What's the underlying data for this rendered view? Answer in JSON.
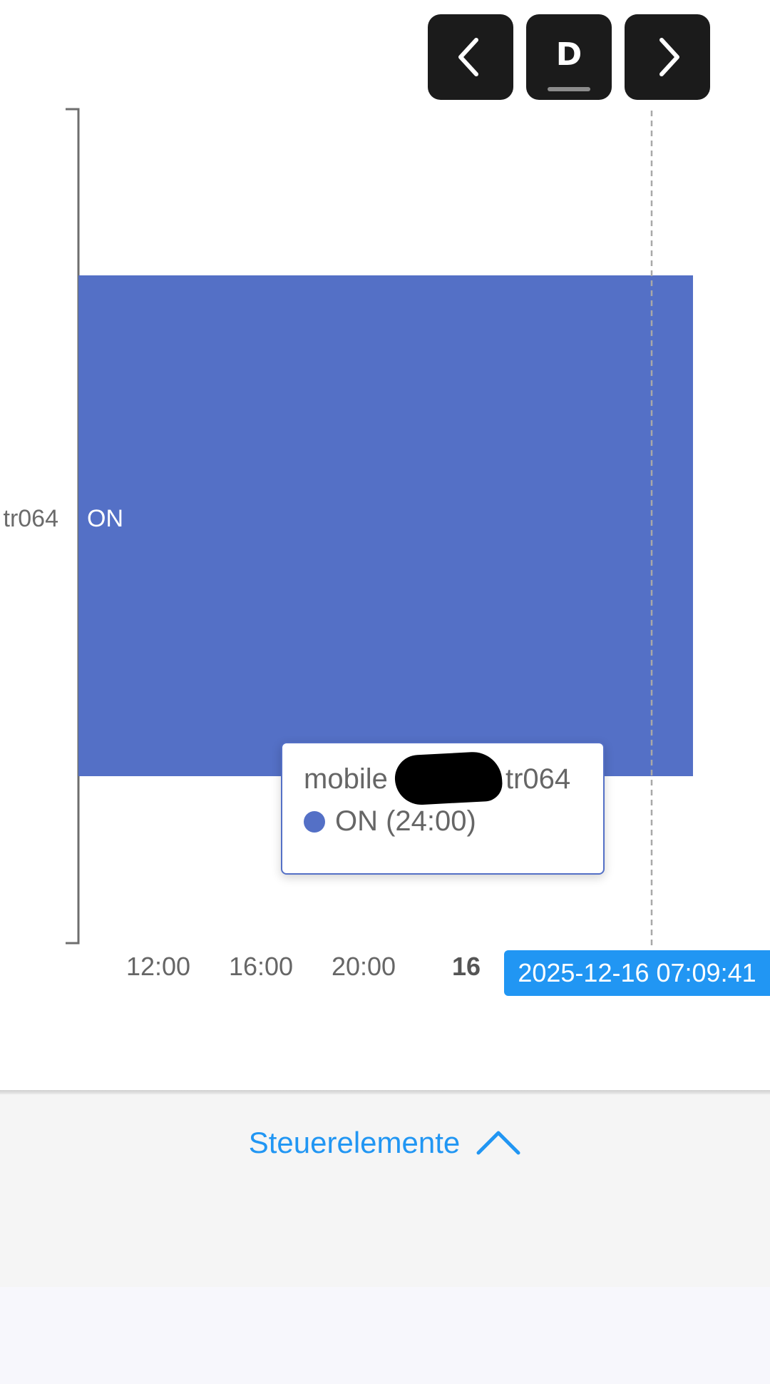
{
  "toolbar": {
    "prev_icon": "chevron-left-icon",
    "period_label": "D",
    "next_icon": "chevron-right-icon"
  },
  "chart_data": {
    "type": "bar",
    "orientation": "horizontal",
    "category": "tr064",
    "bar_label": "ON",
    "color": "#5470c6",
    "x_ticks": [
      "12:00",
      "16:00",
      "20:00",
      "16"
    ],
    "bold_tick": "16",
    "cursor_label": "2025-12-16 07:09:41",
    "tooltip": {
      "title_start": "mobile ",
      "title_end": "tr064",
      "value": "ON (24:00)"
    }
  },
  "controls": {
    "label": "Steuerelemente",
    "icon": "chevron-up-icon",
    "accent": "#2196f3"
  }
}
